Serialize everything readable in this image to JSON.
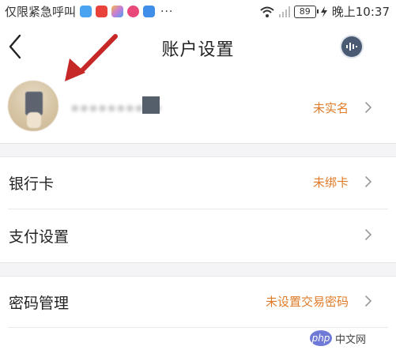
{
  "status_bar": {
    "left_text": "仅限紧急呼叫",
    "app_icons": [
      {
        "name": "app-icon-blue",
        "color": "#4aa3f0"
      },
      {
        "name": "app-icon-red",
        "color": "#e8423a"
      },
      {
        "name": "app-icon-multicolor",
        "color": "#c77dd8"
      },
      {
        "name": "app-icon-pink",
        "color": "#e8487a"
      },
      {
        "name": "app-icon-lightbulb",
        "color": "#3f8ee8"
      }
    ],
    "more": "···",
    "battery": "89",
    "time": "晚上10:37"
  },
  "header": {
    "title": "账户设置"
  },
  "profile": {
    "status": "未实名"
  },
  "rows": {
    "bank_card": {
      "label": "银行卡",
      "status": "未绑卡"
    },
    "payment_settings": {
      "label": "支付设置"
    },
    "password_management": {
      "label": "密码管理",
      "status": "未设置交易密码"
    }
  },
  "watermark": {
    "brand": "php",
    "site": "中文网"
  },
  "colors": {
    "accent": "#e07b28",
    "annotation_arrow": "#c62828",
    "background": "#ffffff",
    "band": "#f4f4f6"
  }
}
